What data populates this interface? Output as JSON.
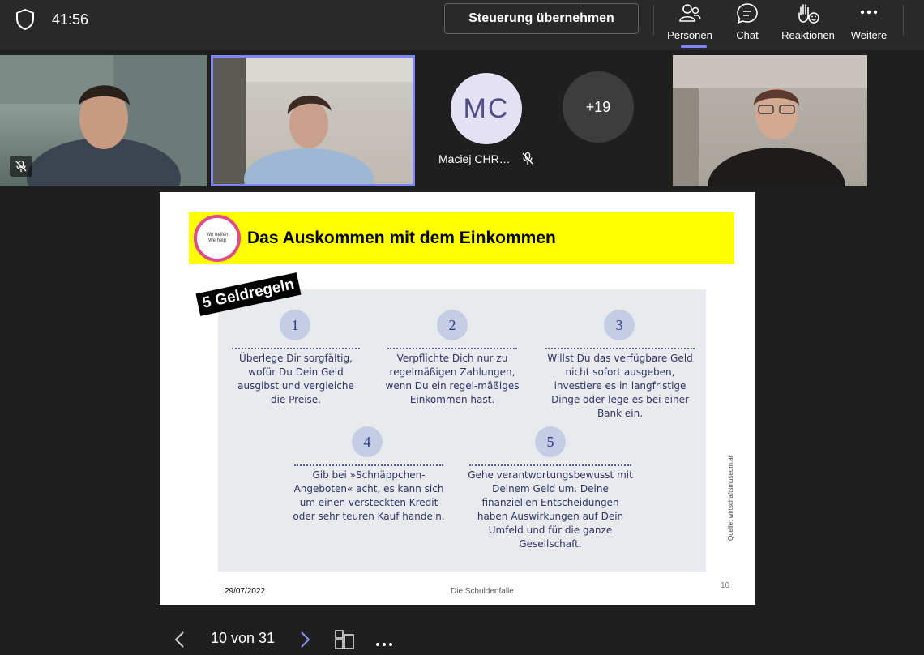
{
  "meeting": {
    "timer": "41:56",
    "takeover_label": "Steuerung übernehmen",
    "toolbar": [
      {
        "label": "Personen",
        "icon": "people-icon",
        "active": true
      },
      {
        "label": "Chat",
        "icon": "chat-icon"
      },
      {
        "label": "Reaktionen",
        "icon": "raise-hand-icon"
      },
      {
        "label": "Weitere",
        "icon": "more-icon"
      }
    ]
  },
  "participants": {
    "mc_initials": "MC",
    "mc_name": "Maciej CHR…",
    "overflow_count": "+19"
  },
  "slide": {
    "title": "Das Auskommen mit dem Einkommen",
    "logo_line1": "Wir helfen",
    "logo_line2": "We help",
    "stamp": "5 Geldregeln",
    "rules": [
      {
        "number": "1",
        "text": "Überlege Dir sorgfältig, wofür Du Dein Geld ausgibst und vergleiche die Preise."
      },
      {
        "number": "2",
        "text": "Verpflichte Dich nur zu regelmäßigen Zahlungen, wenn Du ein regel-mäßiges Einkommen hast."
      },
      {
        "number": "3",
        "text": "Willst Du das verfügbare Geld nicht sofort ausgeben, investiere es in langfristige Dinge oder lege es bei einer Bank ein."
      },
      {
        "number": "4",
        "text": "Gib bei »Schnäppchen-Angeboten« acht, es kann sich um einen versteckten Kredit oder sehr teuren Kauf handeln."
      },
      {
        "number": "5",
        "text": "Gehe verantwortungsbewusst mit Deinem Geld um. Deine finanziellen Entscheidungen haben Auswirkungen auf Dein Umfeld und für die ganze Gesellschaft."
      }
    ],
    "source": "Quelle: wirtschaftsmuseum.at",
    "footer_date": "29/07/2022",
    "footer_center": "Die Schuldenfalle",
    "page_number": "10"
  },
  "navigation": {
    "pager": "10 von 31"
  },
  "colors": {
    "accent": "#7f85f5",
    "banner": "#ffff00",
    "background": "#1f1f1f"
  }
}
